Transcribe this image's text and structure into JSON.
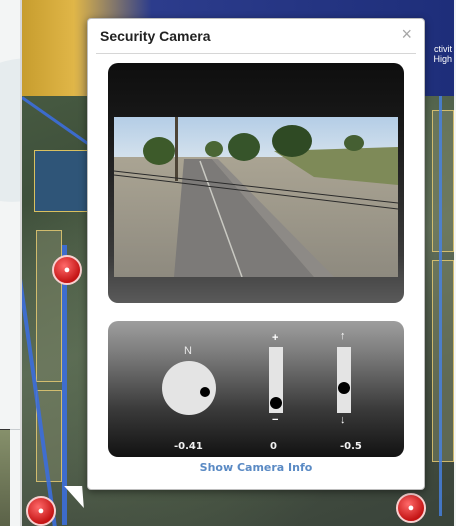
{
  "popup": {
    "title": "Security Camera",
    "close_label": "×",
    "info_link": "Show Camera Info"
  },
  "map": {
    "header_text_line1": "ctivit",
    "header_text_line2": "High"
  },
  "controls": {
    "compass_label": "N",
    "pan_value": "-0.41",
    "zoom_value": "0",
    "tilt_value": "-0.5",
    "zoom_plus": "+",
    "zoom_minus": "−",
    "tilt_up": "↑",
    "tilt_down": "↓"
  },
  "colors": {
    "link": "#5a8ac4",
    "marker": "#c41414",
    "header_gold": "#c79d2e",
    "header_blue": "#1e2e7a"
  },
  "icons": {
    "close": "close-icon",
    "marker": "camera-marker-icon",
    "compass": "compass-icon"
  }
}
